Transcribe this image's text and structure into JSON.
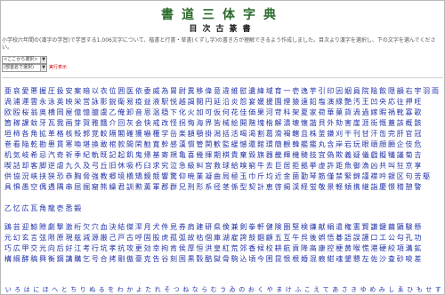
{
  "header": {
    "title": "書道三体字典",
    "subtitle": "目次古篆書"
  },
  "description": "小学校六年間の(漢字の学習)で学習する1,006文字について、楷書と行書・草書(くずし字)の書き方が理解できるよう作成しました。目次より漢字を選択し、下の文字を選んでください。",
  "controls": {
    "select_script_value": "<ここから選択>",
    "select_order_value": "(部首名で選択)",
    "run_button_label": "実行表示"
  },
  "kanji_rows": [
    "亜哀愛悪握圧扱安案暗以衣位囲医依委威為胃尉異移偉意違維慰遺緯域育一壱逸芋引印因姻員院陰飲隠韻右宇羽雨",
    "渦浦運雲永泳英映栄営詠影鋭衛易疫益液駅悦越謁閲円延沿炎怨宴媛援園煙猿遠鉛塩演縁艶汚王凹央応往押旺",
    "欧殴桜翁奥横岡屋億憶臆虞乙俺卸音恩温穏下化火加可仮何花佳価果河苛科架夏家荷華菓貨渦過嫁暇禍靴寡歌",
    "箇稼課蚊牙瓦我画芽賀雅餓介回灰会快戒改怪拐悔海界皆械絵開階塊楷解潰壊懐諧貝外劾害崖涯街慨蓋該概骸",
    "垣柿各角拡革格核殻郭覚較隔閣確獲嚇穫学岳楽額顎掛潟括活喝渇割葛滑褐轄且株釜鎌刈干刊甘汗缶完肝官冠",
    "巻看陥乾勘患貫寒喚堪換敢棺款間閑勧寛幹感漢慣管関歓監緩憾還館環簡観韓艦鑑丸含岸岩玩眼頑顔願企伎危",
    "机気岐希忌汽奇祈季紀軌既記起飢鬼帰基寄規亀喜幾揮期棋貴棄毀旗器畿輝機騎技宜偽欺義疑儀戯擬犠議菊吉",
    "喫詰却客脚逆虐九久及弓丘旧休吸朽臼求究泣急級糾宮救球給嗅窮牛去巨居拒拠挙虚許距魚御漁凶共叫狂京享",
    "供協況峡挟狭恐恭胸脅強教郷境橋矯鏡競響驚仰暁業凝曲局極玉巾斤均近金菌勤琴筋僅禁緊錦謹襟吟銀区句苦駆",
    "具惧愚空偶遇隅串屈掘窟熊繰君訓勲薫軍郡群兄刑形系径茎係型契計恵啓掲渓経蛍敬景軽傾携継詣慶憬稽憩警",
    "乙忆広瓦角龍壱悉鍛",
    "鶏芸迎鯨隙劇撃激桁欠穴血決結傑潔月犬件見券肩建研県倹兼剣拳軒健険圏堅検嫌献絹遣権憲賢謙鍵繭顕験懸",
    "元幻玄言弦限原現舷減源厳己戸古呼固股虎孤弧故枯個庫湖雇誇鼓錮顧五互午呉後娯悟碁語誤護口工公勾孔功",
    "巧広甲交光向后好江考行坑孝抗攻更効幸拘肯侯厚恒洪皇紅荒郊香候校耕航貢降高康控梗黄喉慌港硬絞項溝鉱",
    "構綱酵稿興衡鋼講購乞号合拷剛傲豪克告谷刻国黒穀酷獄骨駒込頃今困昆恨根婚混痕紺魂墾懇左佐沙査砂唆差"
  ],
  "kana_row": "いろはにほへとちりぬるをわかよたれそつねならむうゐのおくやまけふこえてあさきゆめみしゑひもせすん"
}
